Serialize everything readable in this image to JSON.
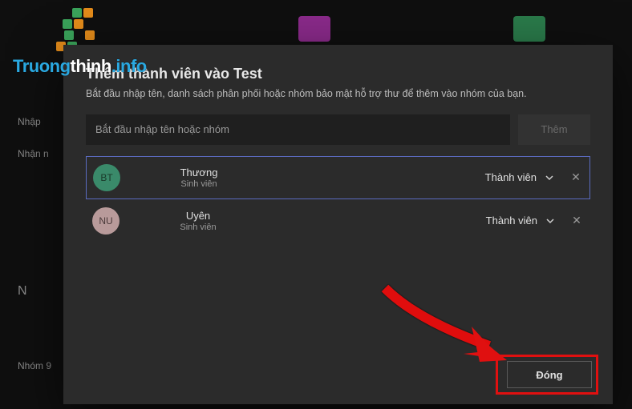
{
  "dialog": {
    "title": "Thêm thành viên vào Test",
    "subtitle": "Bắt đầu nhập tên, danh sách phân phối hoặc nhóm bảo mật hỗ trợ thư để thêm vào nhóm của bạn.",
    "input_placeholder": "Bắt đầu nhập tên hoặc nhóm",
    "add_label": "Thêm",
    "close_label": "Đóng"
  },
  "members": [
    {
      "initials": "BT",
      "name": "Thương",
      "subtitle": "Sinh viên",
      "role": "Thành viên",
      "selected": true,
      "avatarClass": "bt"
    },
    {
      "initials": "NU",
      "name": "Uyên",
      "subtitle": "Sinh viên",
      "role": "Thành viên",
      "selected": false,
      "avatarClass": "nu"
    }
  ],
  "watermark": {
    "prefix": "Truong",
    "mid": "thinh",
    "suffix": ".info"
  },
  "bg": {
    "label_left_top": "Nhập",
    "label_left_mid": "Nhận n",
    "label_left_bottom": "N",
    "label_bottom": "Nhóm 9"
  }
}
